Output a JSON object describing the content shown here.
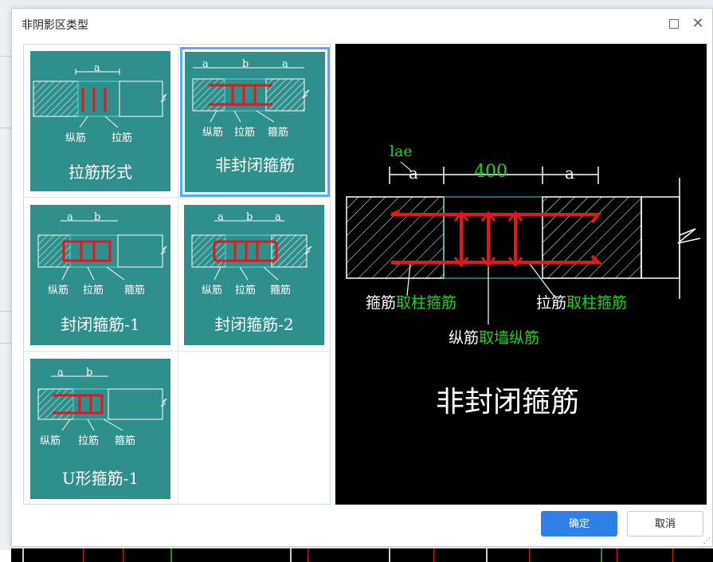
{
  "dialog": {
    "title": "非阴影区类型",
    "ok_label": "确定",
    "cancel_label": "取消"
  },
  "options": [
    {
      "caption": "拉筋形式",
      "dim_labels": [
        "a"
      ],
      "parts": [
        "纵筋",
        "拉筋"
      ],
      "selected": false
    },
    {
      "caption": "非封闭箍筋",
      "dim_labels": [
        "a",
        "b",
        "a"
      ],
      "parts": [
        "纵筋",
        "拉筋",
        "箍筋"
      ],
      "selected": true
    },
    {
      "caption": "封闭箍筋-1",
      "dim_labels": [
        "a",
        "b"
      ],
      "parts": [
        "纵筋",
        "拉筋",
        "箍筋"
      ],
      "selected": false
    },
    {
      "caption": "封闭箍筋-2",
      "dim_labels": [
        "a",
        "b",
        "a"
      ],
      "parts": [
        "纵筋",
        "拉筋",
        "箍筋"
      ],
      "selected": false
    },
    {
      "caption": "U形箍筋-1",
      "dim_labels": [
        "a",
        "b"
      ],
      "parts": [
        "纵筋",
        "拉筋",
        "箍筋"
      ],
      "selected": false
    }
  ],
  "preview": {
    "lae_label": "lae",
    "dim_left": "a",
    "dim_middle": "400",
    "dim_right": "a",
    "stirrup_label": "箍筋",
    "stirrup_value": "取柱箍筋",
    "tie_label": "拉筋",
    "tie_value": "取柱箍筋",
    "long_label": "纵筋",
    "long_value": "取墙纵筋",
    "caption": "非封闭箍筋"
  },
  "colors": {
    "tile_bg": "#2e8f8b",
    "accent_blue": "#2f80e8",
    "rebar_red": "#e8141e",
    "highlight_green": "#1fd11f"
  }
}
